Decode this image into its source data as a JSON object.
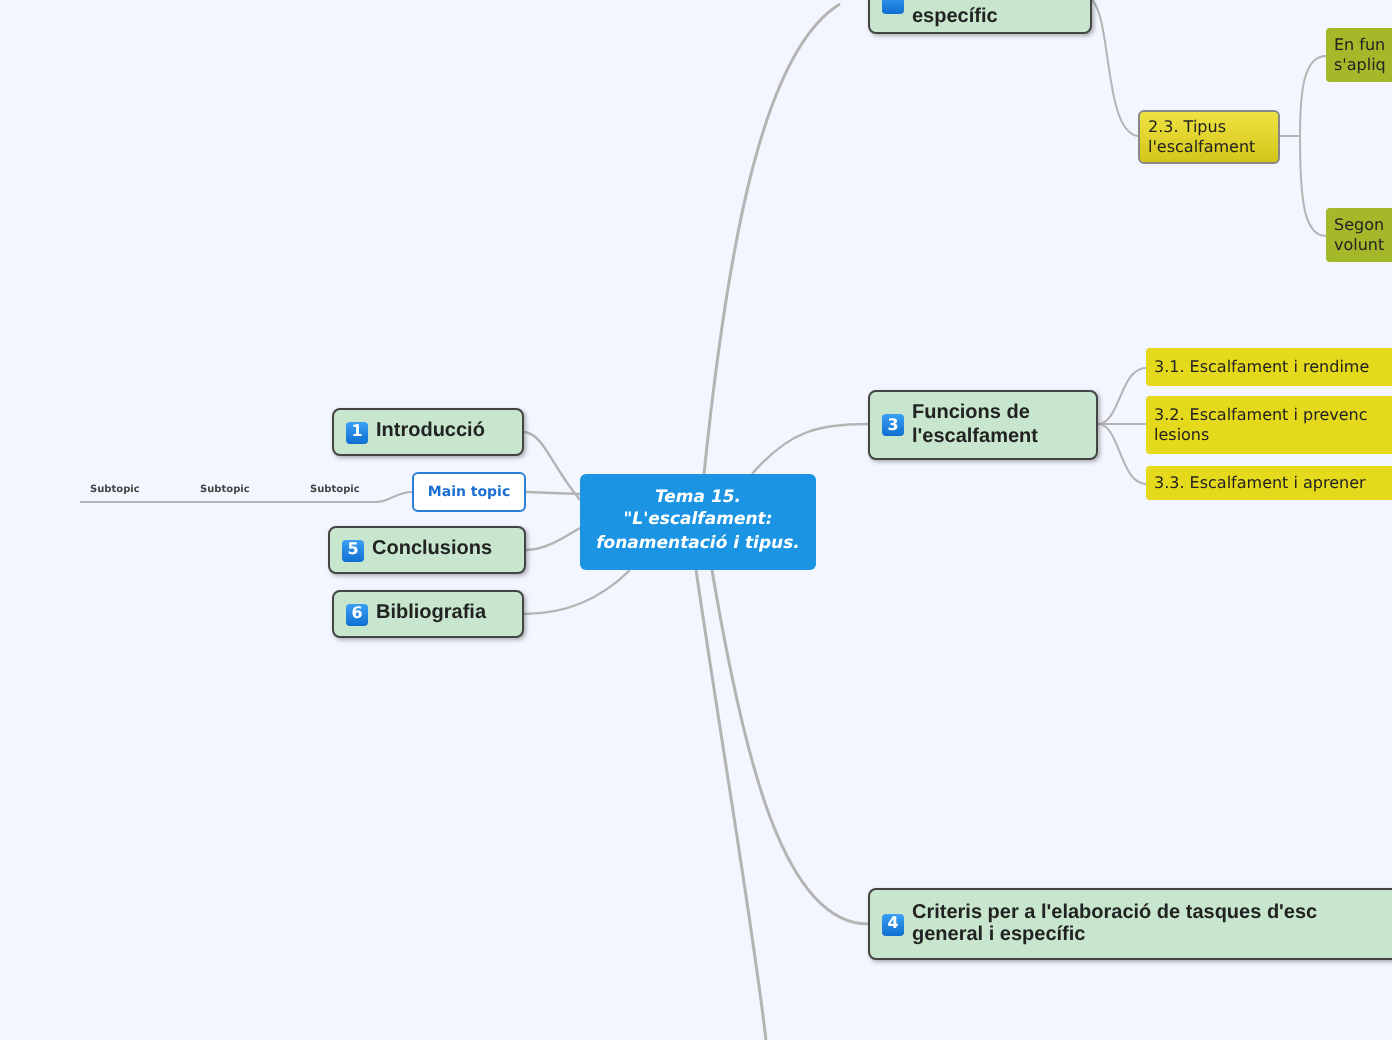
{
  "mind_map": {
    "nodes": [
      {
        "kind": "central",
        "text": "Tema 15.\n\"L'escalfament:\nfonamentació i tipus."
      },
      {
        "kind": "main",
        "badge": "1",
        "text": "Introducció"
      },
      {
        "kind": "subtopic",
        "text": "Subtopic"
      },
      {
        "kind": "subtopic",
        "text": "Subtopic"
      },
      {
        "kind": "subtopic",
        "text": "Subtopic"
      },
      {
        "kind": "plain",
        "text": "Main topic"
      },
      {
        "kind": "main",
        "badge": "5",
        "text": "Conclusions"
      },
      {
        "kind": "main",
        "badge": "6",
        "text": "Bibliografia"
      },
      {
        "kind": "main_cut",
        "text": "específic"
      },
      {
        "kind": "sub",
        "text": "2.3. Tipus\nl'escalfament"
      },
      {
        "kind": "detail",
        "text": "En fun\ns'apliq"
      },
      {
        "kind": "detail",
        "text": "Segon\nvolunt"
      },
      {
        "kind": "main",
        "badge": "3",
        "text": "Funcions de\nl'escalfament"
      },
      {
        "kind": "leaf",
        "text": "3.1. Escalfament i rendime"
      },
      {
        "kind": "leaf",
        "text": "3.2. Escalfament i prevenc\nlesions"
      },
      {
        "kind": "leaf",
        "text": "3.3. Escalfament i aprener"
      },
      {
        "kind": "main",
        "badge": "4",
        "text": "Criteris per a l'elaboració de tasques d'esc\ngeneral i específic"
      }
    ]
  }
}
